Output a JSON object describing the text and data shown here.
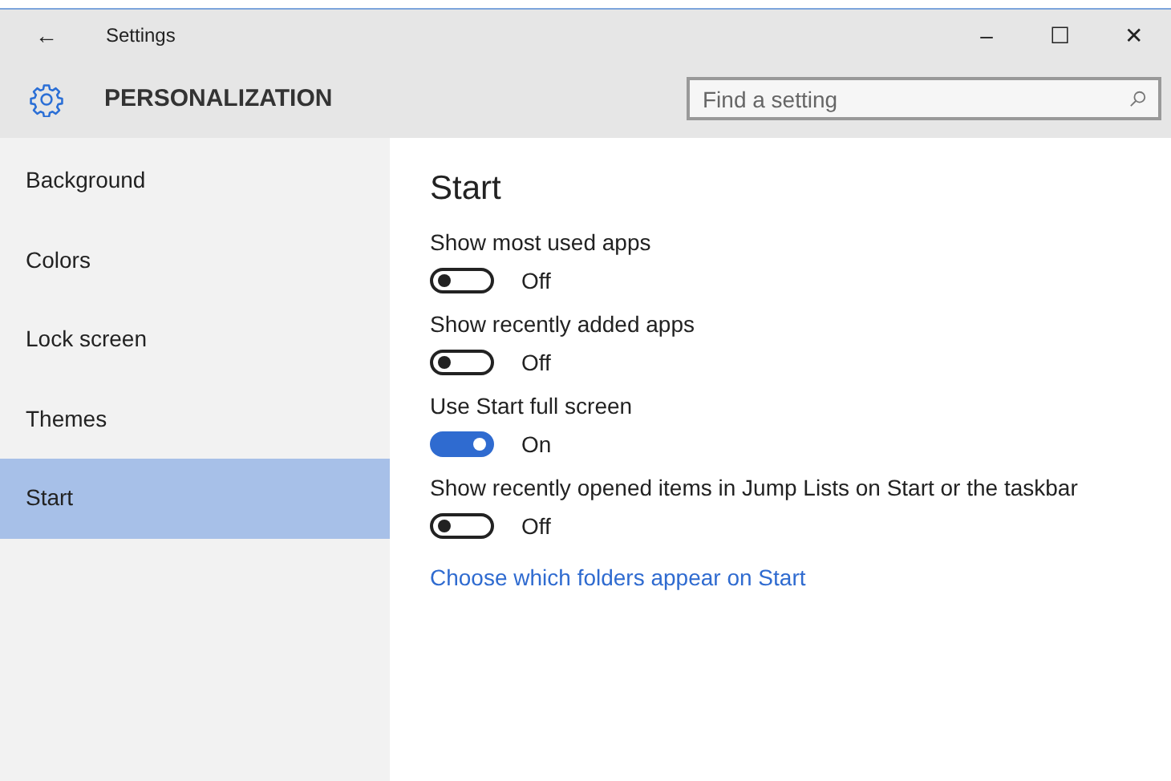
{
  "window": {
    "title": "Settings",
    "back": "←",
    "controls": [
      "–",
      "☐",
      "✕"
    ]
  },
  "header": {
    "title": "PERSONALIZATION"
  },
  "search": {
    "placeholder": "Find a setting"
  },
  "sidebar": {
    "items": [
      {
        "label": "Background",
        "selected": false
      },
      {
        "label": "Colors",
        "selected": false
      },
      {
        "label": "Lock screen",
        "selected": false
      },
      {
        "label": "Themes",
        "selected": false
      },
      {
        "label": "Start",
        "selected": true
      }
    ]
  },
  "content": {
    "title": "Start",
    "settings": [
      {
        "label": "Show most used apps",
        "on": false,
        "state_text": "Off"
      },
      {
        "label": "Show recently added apps",
        "on": false,
        "state_text": "Off"
      },
      {
        "label": "Use Start full screen",
        "on": true,
        "state_text": "On"
      },
      {
        "label": "Show recently opened items in Jump Lists on Start or the taskbar",
        "on": false,
        "state_text": "Off"
      }
    ],
    "link": "Choose which folders appear on Start"
  }
}
